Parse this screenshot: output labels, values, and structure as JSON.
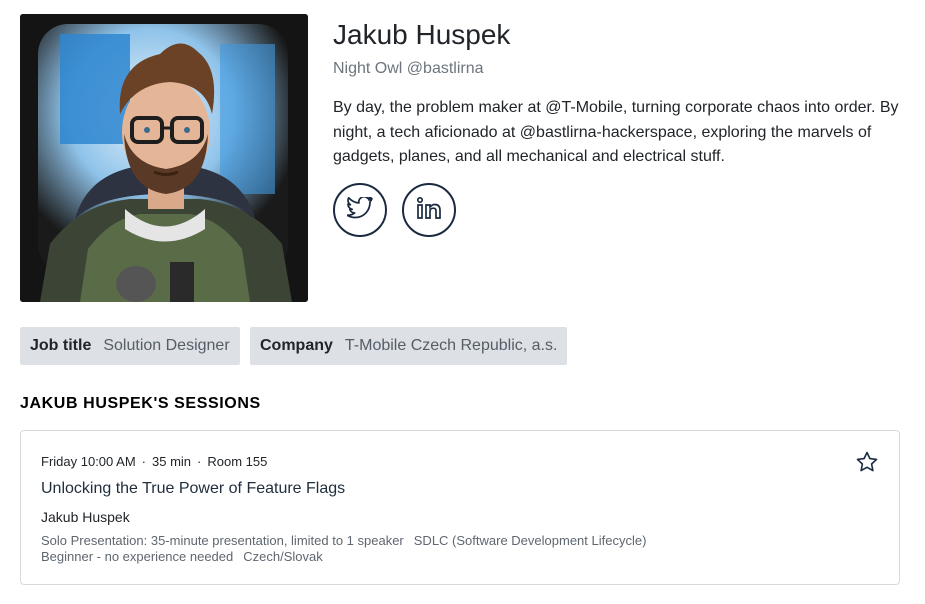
{
  "profile": {
    "name": "Jakub Huspek",
    "tagline": "Night Owl @bastlirna",
    "bio": "By day, the problem maker at @T-Mobile, turning corporate chaos into order. By night, a tech aficionado at @bastlirna-hackerspace, exploring the marvels of gadgets, planes, and all mechanical and electrical stuff.",
    "social": [
      {
        "icon": "twitter-icon"
      },
      {
        "icon": "linkedin-icon"
      }
    ]
  },
  "info": {
    "job_title_label": "Job title",
    "job_title_value": "Solution Designer",
    "company_label": "Company",
    "company_value": "T-Mobile Czech Republic, a.s."
  },
  "sessions": {
    "heading": "JAKUB HUSPEK'S SESSIONS",
    "items": [
      {
        "day_time": "Friday 10:00 AM",
        "duration": "35 min",
        "room": "Room 155",
        "title": "Unlocking the True Power of Feature Flags",
        "speaker": "Jakub Huspek",
        "format": "Solo Presentation: 35-minute presentation, limited to 1 speaker",
        "track": "SDLC (Software Development Lifecycle)",
        "level": "Beginner - no experience needed",
        "language": "Czech/Slovak",
        "favorite_icon": "star-icon"
      }
    ]
  },
  "colors": {
    "accent": "#1b2a41",
    "chip_bg": "#dde1e6",
    "border": "#d6d9dc"
  }
}
